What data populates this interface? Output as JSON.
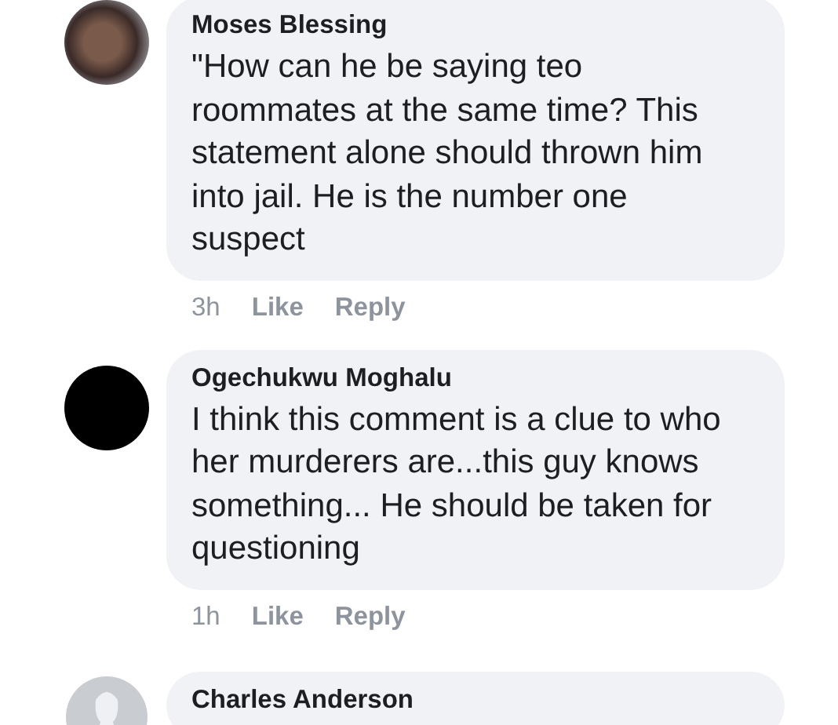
{
  "comments": [
    {
      "kind": "photo",
      "author": "Moses Blessing",
      "text": "\"How can he be saying teo roommates at the same time? This statement alone should thrown him into jail. He is the number one suspect",
      "time": "3h",
      "actions": [
        "Like",
        "Reply"
      ]
    },
    {
      "kind": "blank",
      "author": "Ogechukwu Moghalu",
      "text": "I think this comment is a clue to who her murderers are...this guy knows something... He should be taken for questioning",
      "time": "1h",
      "actions": [
        "Like",
        "Reply"
      ]
    },
    {
      "kind": "silhouette",
      "author": "Charles Anderson"
    }
  ]
}
